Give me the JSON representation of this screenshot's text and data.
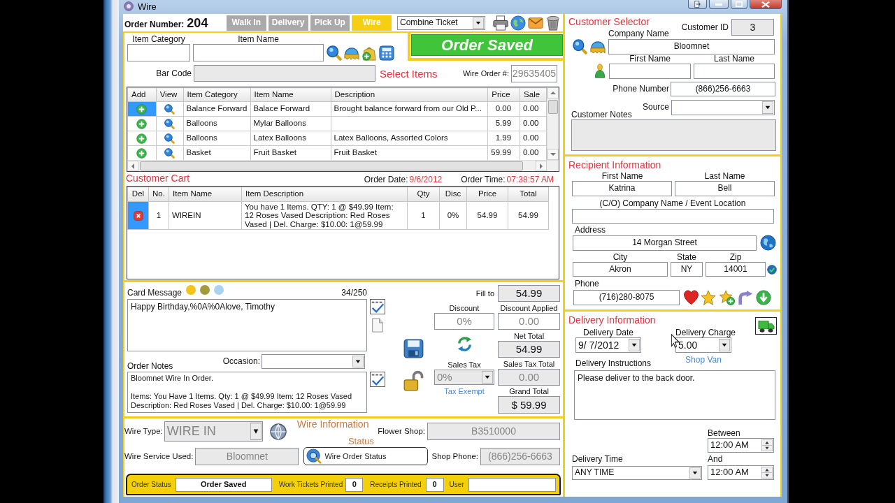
{
  "window": {
    "title": "Wire"
  },
  "header": {
    "order_number_label": "Order Number:",
    "order_number": "204",
    "tabs": [
      {
        "label": "Walk In",
        "selected": false
      },
      {
        "label": "Delivery",
        "selected": false
      },
      {
        "label": "Pick Up",
        "selected": false
      },
      {
        "label": "Wire",
        "selected": true
      }
    ],
    "ticket_type": {
      "value": "Combine Ticket"
    }
  },
  "select_items": {
    "item_category": {
      "label": "Item Category"
    },
    "item_name": {
      "label": "Item Name"
    },
    "status_banner": "Order Saved",
    "bar_code": {
      "label": "Bar Code",
      "read_only": true
    },
    "title": "Select Items",
    "wire_order": {
      "label": "Wire Order #:",
      "value": "29635405",
      "disabled": true
    },
    "table": {
      "columns": [
        "Add",
        "View",
        "Item Category",
        "Item Name",
        "Description",
        "Price",
        "Sale"
      ],
      "rows": [
        {
          "selected": true,
          "category": "Balance Forward",
          "name": "Balace Forward",
          "description": "Brought balance forward from our Old P...",
          "price": "0.00",
          "sale": "0.00"
        },
        {
          "selected": false,
          "category": "Balloons",
          "name": "Mylar Balloons",
          "price": "5.99",
          "sale": "0.00"
        },
        {
          "selected": false,
          "category": "Balloons",
          "name": "Latex Balloons",
          "description": "Latex Balloons, Assorted Colors",
          "price": "1.99",
          "sale": "0.00"
        },
        {
          "selected": false,
          "category": "Basket",
          "name": "Fruit Basket",
          "description": "Fruit Basket",
          "price": "59.99",
          "sale": "0.00"
        }
      ]
    }
  },
  "customer_cart": {
    "title": "Customer Cart",
    "order_date": {
      "label": "Order Date:",
      "value": "9/6/2012"
    },
    "order_time": {
      "label": "Order Time:",
      "value": "07:38:57 AM"
    },
    "table": {
      "columns": [
        "Del",
        "No.",
        "Item Name",
        "Item Description",
        "Qty",
        "Disc",
        "Price",
        "Total"
      ],
      "rows": [
        {
          "selected": true,
          "no": "1",
          "item_name": "WIREIN",
          "description": "You have 1 Items. QTY: 1 @ $49.99 Item: 12 Roses Vased Description: Red Roses Vased | Del. Charge: $10.00: 1@59.99",
          "qty": "1",
          "disc": "0%",
          "price": "54.99",
          "total": "54.99"
        }
      ]
    }
  },
  "card_message": {
    "label": "Card Message",
    "colors": [
      {
        "color": "#f2c31a"
      },
      {
        "color": "#a39a3c"
      },
      {
        "color": "#a9d3ef"
      }
    ],
    "count": "34/250",
    "value": "Happy Birthday,%0A%0Alove, Timothy"
  },
  "order_notes": {
    "label": "Order Notes",
    "value": "Bloomnet Wire In Order.\n\nItems: You Have 1 Items. Qty: 1 @ $49.99 Item: 12 Roses Vased\nDescription: Red Roses Vased | Del. Charge: $10.00: 1@59.99"
  },
  "occasion": {
    "label": "Occasion:"
  },
  "totals": {
    "fill_to": {
      "label": "Fill to",
      "value": "54.99",
      "read_only": true
    },
    "discount": {
      "label": "Discount",
      "value": "0%",
      "disabled": true
    },
    "discount_applied": {
      "label": "Discount Applied",
      "value": "0.00",
      "disabled": true
    },
    "net_total": {
      "label": "Net Total",
      "value": "54.99",
      "read_only": true
    },
    "sales_tax": {
      "label": "Sales Tax",
      "value": "0%",
      "read_only": true,
      "disabled": true
    },
    "sales_tax_total": {
      "label": "Sales Tax Total",
      "value": "0.00",
      "read_only": true,
      "disabled": true
    },
    "tax_exempt": "Tax Exempt",
    "grand_total": {
      "label": "Grand Total",
      "value": "$ 59.99",
      "read_only": true
    }
  },
  "wire_information": {
    "title": "Wire Information",
    "status_title": "Status",
    "wire_type": {
      "label": "Wire Type:",
      "value": "WIRE IN",
      "read_only": true,
      "disabled": true
    },
    "flower_shop": {
      "label": "Flower Shop:",
      "value": "B3510000",
      "read_only": true,
      "disabled": true
    },
    "wire_service": {
      "label": "Wire Service Used:",
      "value": "Bloomnet",
      "read_only": true,
      "disabled": true
    },
    "status_button": "Wire Order Status",
    "shop_phone": {
      "label": "Shop Phone:",
      "value": "(866)256-6663",
      "read_only": true,
      "disabled": true
    }
  },
  "status_bar": {
    "order_status": {
      "label": "Order Status",
      "value": "Order Saved"
    },
    "work_tickets_printed": {
      "label": "Work Tickets Printed",
      "value": "0"
    },
    "receipts_printed": {
      "label": "Receipts Printed",
      "value": "0"
    },
    "user": {
      "label": "User"
    }
  },
  "customer_selector": {
    "title": "Customer Selector",
    "customer_id": {
      "label": "Customer ID",
      "value": "3",
      "read_only": true
    },
    "company_name": {
      "label": "Company Name",
      "value": "Bloomnet"
    },
    "first_name": {
      "label": "First Name"
    },
    "last_name": {
      "label": "Last Name"
    },
    "phone_number": {
      "label": "Phone Number",
      "value": "(866)256-6663"
    },
    "source": {
      "label": "Source"
    },
    "customer_notes": {
      "label": "Customer Notes",
      "read_only": true
    }
  },
  "recipient_information": {
    "title": "Recipient Information",
    "first_name": {
      "label": "First Name",
      "value": "Katrina"
    },
    "last_name": {
      "label": "Last Name",
      "value": "Bell"
    },
    "company_location": {
      "label": "(C/O) Company Name / Event Location"
    },
    "address": {
      "label": "Address",
      "value": "14 Morgan Street"
    },
    "city": {
      "label": "City",
      "value": "Akron"
    },
    "state": {
      "label": "State",
      "value": "NY"
    },
    "zip": {
      "label": "Zip",
      "value": "14001"
    },
    "phone": {
      "label": "Phone",
      "value": "(716)280-8075"
    }
  },
  "delivery_information": {
    "title": "Delivery Information",
    "delivery_date": {
      "label": "Delivery Date",
      "value": "9/ 7/2012"
    },
    "delivery_charge": {
      "label": "Delivery Charge",
      "value": "5.00"
    },
    "shop_van": "Shop Van",
    "delivery_instructions": {
      "label": "Delivery Instructions",
      "value": "Please deliver to the back door."
    },
    "between": {
      "label": "Between",
      "value": "12:00 AM"
    },
    "delivery_time": {
      "label": "Delivery Time",
      "value": "ANY TIME"
    },
    "and": {
      "label": "And",
      "value": "12:00 AM"
    }
  }
}
